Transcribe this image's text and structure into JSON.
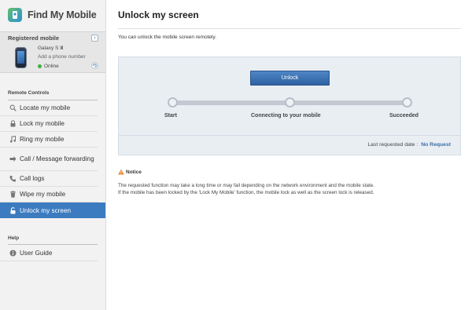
{
  "app": {
    "title": "Find My Mobile"
  },
  "device": {
    "heading": "Registered mobile",
    "model": "Galaxy S Ⅲ",
    "add_number": "Add a phone number",
    "status": "Online"
  },
  "sidebar": {
    "remote_controls_title": "Remote Controls",
    "items": [
      {
        "label": "Locate my mobile",
        "icon": "search-icon"
      },
      {
        "label": "Lock my mobile",
        "icon": "lock-icon"
      },
      {
        "label": "Ring my mobile",
        "icon": "music-note-icon"
      },
      {
        "label": "Call / Message forwarding",
        "icon": "forward-icon"
      },
      {
        "label": "Call logs",
        "icon": "phone-icon"
      },
      {
        "label": "Wipe my mobile",
        "icon": "trash-icon"
      },
      {
        "label": "Unlock my screen",
        "icon": "unlock-icon",
        "active": true
      }
    ],
    "help_title": "Help",
    "help_items": [
      {
        "label": "User Guide",
        "icon": "info-icon"
      }
    ]
  },
  "main": {
    "title": "Unlock my screen",
    "intro": "You can unlock the mobile screen remotely.",
    "unlock_button": "Unlock",
    "steps": [
      "Start",
      "Connecting to your mobile",
      "Succeeded"
    ],
    "last_requested_label": "Last requested date :",
    "last_requested_value": "No Request",
    "notice_title": "Notice",
    "notice_lines": [
      "The requested function may take a long time or may fail depending on the network environment and the mobile state.",
      "If the mobile has been locked by the 'Lock My Mobile' function, the mobile lock as well as the screen lock is released."
    ]
  },
  "colors": {
    "accent": "#3c7bc0",
    "button": "#3a6fb0",
    "online": "#3cb043",
    "link": "#3a6ea5"
  }
}
